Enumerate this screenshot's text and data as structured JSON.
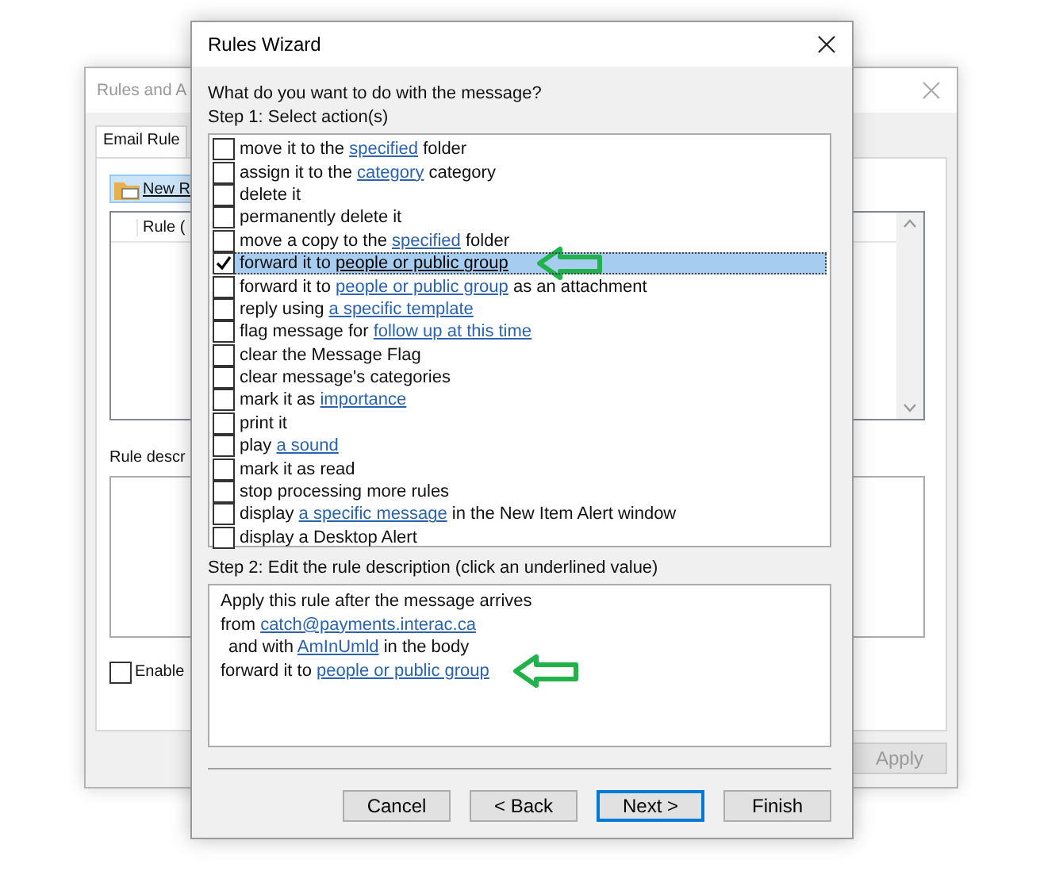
{
  "background_window": {
    "title": "Rules and A",
    "tab": "Email Rule",
    "new_rule_button": "New R",
    "column_header": "Rule (",
    "description_label": "Rule descr",
    "enable_checkbox": {
      "label": "Enable",
      "checked": false
    },
    "apply_button": {
      "label": "Apply",
      "disabled": true
    }
  },
  "wizard": {
    "title": "Rules Wizard",
    "question": "What do you want to do with the message?",
    "step1_label": "Step 1: Select action(s)",
    "actions": [
      {
        "parts": [
          {
            "text": "move it to the "
          },
          {
            "text": "specified",
            "link": true
          },
          {
            "text": " folder"
          }
        ],
        "checked": false,
        "selected": false,
        "arrow": false
      },
      {
        "parts": [
          {
            "text": "assign it to the "
          },
          {
            "text": "category",
            "link": true
          },
          {
            "text": " category"
          }
        ],
        "checked": false,
        "selected": false,
        "arrow": false
      },
      {
        "parts": [
          {
            "text": "delete it"
          }
        ],
        "checked": false,
        "selected": false,
        "arrow": false
      },
      {
        "parts": [
          {
            "text": "permanently delete it"
          }
        ],
        "checked": false,
        "selected": false,
        "arrow": false
      },
      {
        "parts": [
          {
            "text": "move a copy to the "
          },
          {
            "text": "specified",
            "link": true
          },
          {
            "text": " folder"
          }
        ],
        "checked": false,
        "selected": false,
        "arrow": false
      },
      {
        "parts": [
          {
            "text": "forward it to "
          },
          {
            "text": "people or public group",
            "link": true
          }
        ],
        "checked": true,
        "selected": true,
        "arrow": true
      },
      {
        "parts": [
          {
            "text": "forward it to "
          },
          {
            "text": "people or public group",
            "link": true
          },
          {
            "text": " as an attachment"
          }
        ],
        "checked": false,
        "selected": false,
        "arrow": false
      },
      {
        "parts": [
          {
            "text": "reply using "
          },
          {
            "text": "a specific template",
            "link": true
          }
        ],
        "checked": false,
        "selected": false,
        "arrow": false
      },
      {
        "parts": [
          {
            "text": "flag message for "
          },
          {
            "text": "follow up at this time",
            "link": true
          }
        ],
        "checked": false,
        "selected": false,
        "arrow": false
      },
      {
        "parts": [
          {
            "text": "clear the Message Flag"
          }
        ],
        "checked": false,
        "selected": false,
        "arrow": false
      },
      {
        "parts": [
          {
            "text": "clear message's categories"
          }
        ],
        "checked": false,
        "selected": false,
        "arrow": false
      },
      {
        "parts": [
          {
            "text": "mark it as "
          },
          {
            "text": "importance",
            "link": true
          }
        ],
        "checked": false,
        "selected": false,
        "arrow": false
      },
      {
        "parts": [
          {
            "text": "print it"
          }
        ],
        "checked": false,
        "selected": false,
        "arrow": false
      },
      {
        "parts": [
          {
            "text": "play "
          },
          {
            "text": "a sound",
            "link": true
          }
        ],
        "checked": false,
        "selected": false,
        "arrow": false
      },
      {
        "parts": [
          {
            "text": "mark it as read"
          }
        ],
        "checked": false,
        "selected": false,
        "arrow": false
      },
      {
        "parts": [
          {
            "text": "stop processing more rules"
          }
        ],
        "checked": false,
        "selected": false,
        "arrow": false
      },
      {
        "parts": [
          {
            "text": "display "
          },
          {
            "text": "a specific message",
            "link": true
          },
          {
            "text": " in the New Item Alert window"
          }
        ],
        "checked": false,
        "selected": false,
        "arrow": false
      },
      {
        "parts": [
          {
            "text": "display a Desktop Alert"
          }
        ],
        "checked": false,
        "selected": false,
        "arrow": false
      }
    ],
    "step2_label": "Step 2: Edit the rule description (click an underlined value)",
    "description_lines": [
      {
        "parts": [
          {
            "text": "Apply this rule after the message arrives"
          }
        ],
        "indent": false,
        "arrow": false
      },
      {
        "parts": [
          {
            "text": "from "
          },
          {
            "text": "catch@payments.interac.ca",
            "link": true
          }
        ],
        "indent": false,
        "arrow": false
      },
      {
        "parts": [
          {
            "text": "and with "
          },
          {
            "text": "AmInUmld",
            "link": true
          },
          {
            "text": " in the body"
          }
        ],
        "indent": true,
        "arrow": false
      },
      {
        "parts": [
          {
            "text": "forward it to "
          },
          {
            "text": "people or public group",
            "link": true
          }
        ],
        "indent": false,
        "arrow": true
      }
    ],
    "buttons": [
      {
        "label": "Cancel",
        "default": false
      },
      {
        "label": "< Back",
        "default": false
      },
      {
        "label": "Next >",
        "default": true
      },
      {
        "label": "Finish",
        "default": false
      }
    ]
  }
}
